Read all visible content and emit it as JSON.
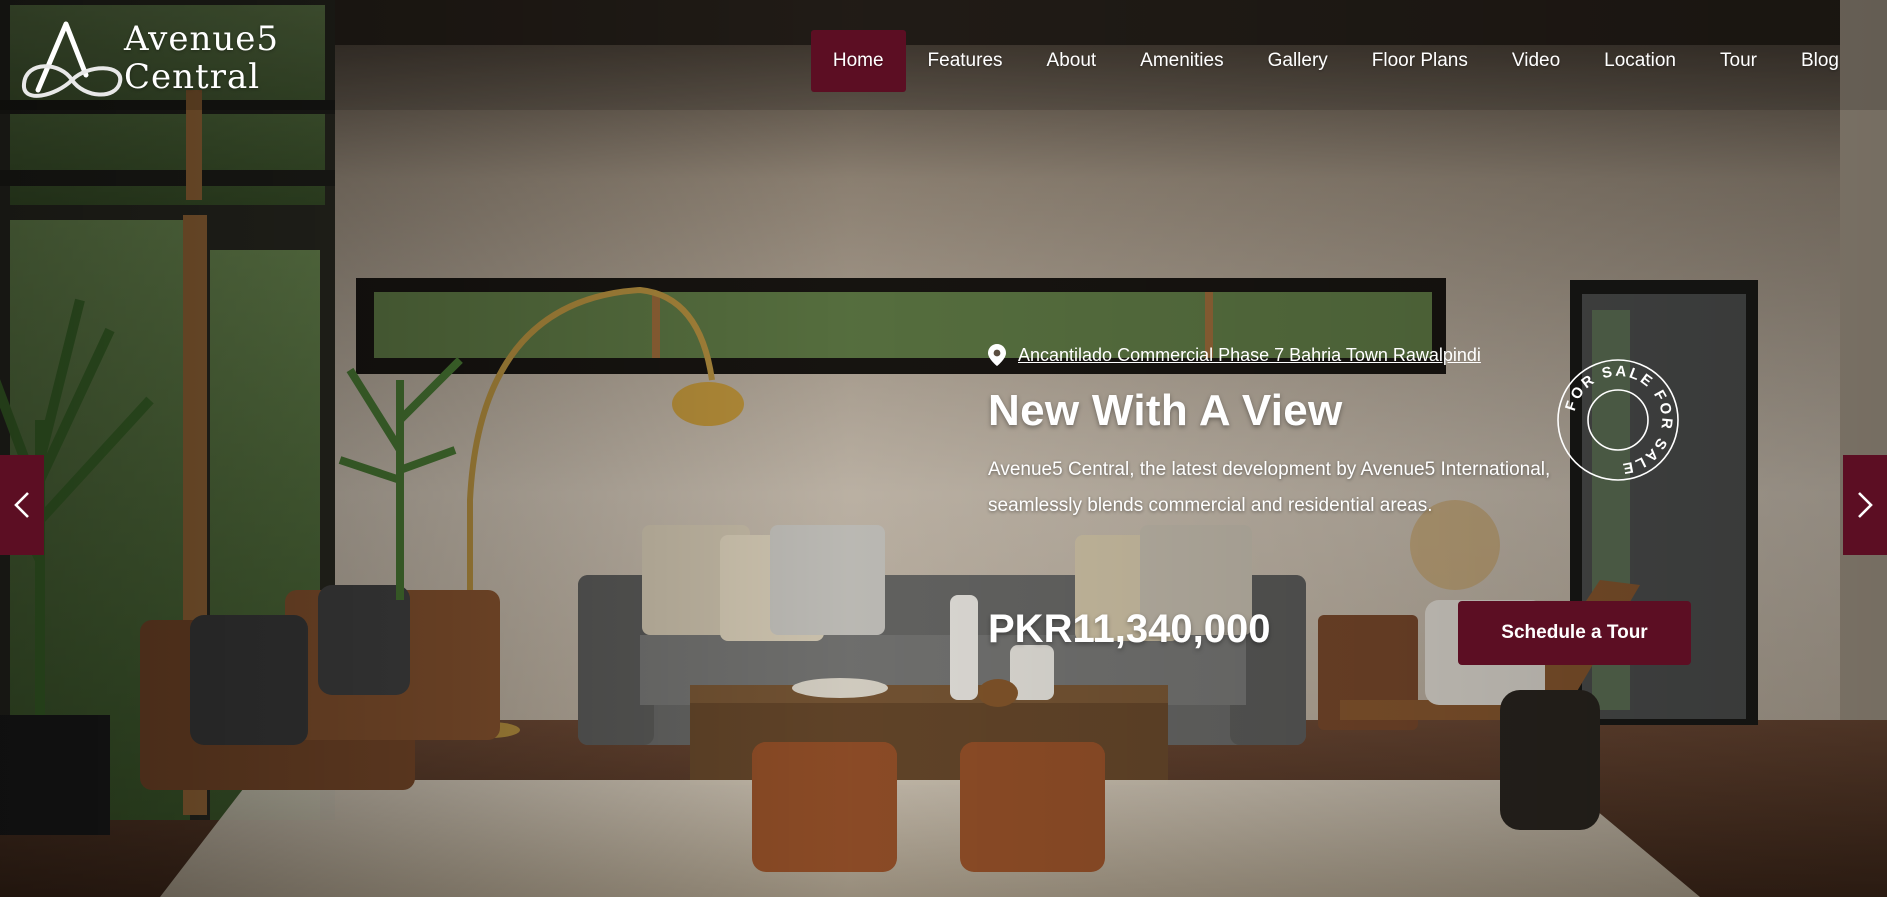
{
  "brand": {
    "line1": "Avenue5",
    "line2": "Central"
  },
  "nav": {
    "items": [
      {
        "label": "Home",
        "active": true
      },
      {
        "label": "Features",
        "active": false
      },
      {
        "label": "About",
        "active": false
      },
      {
        "label": "Amenities",
        "active": false
      },
      {
        "label": "Gallery",
        "active": false
      },
      {
        "label": "Floor Plans",
        "active": false
      },
      {
        "label": "Video",
        "active": false
      },
      {
        "label": "Location",
        "active": false
      },
      {
        "label": "Tour",
        "active": false
      },
      {
        "label": "Blog",
        "active": false
      }
    ]
  },
  "hero": {
    "location": "Ancantilado Commercial Phase 7 Bahria Town Rawalpindi",
    "title": "New With A View",
    "description": "Avenue5 Central, the latest development by Avenue5 International, seamlessly blends commercial and residential areas.",
    "price": "PKR11,340,000",
    "cta_label": "Schedule a Tour",
    "badge_text": "FOR SALE FOR SALE"
  },
  "icons": {
    "location": "map-pin-icon",
    "prev": "chevron-left-icon",
    "next": "chevron-right-icon"
  },
  "colors": {
    "accent": "#5c0e23",
    "text": "#ffffff"
  }
}
